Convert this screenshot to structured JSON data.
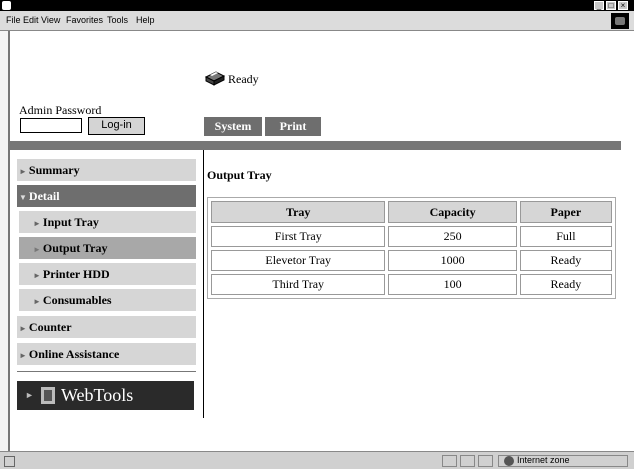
{
  "menubar": {
    "items": [
      "File",
      "Edit",
      "View",
      "Favorites",
      "Tools",
      "Help"
    ]
  },
  "status": {
    "printer_status": "Ready"
  },
  "admin": {
    "password_label": "Admin Password",
    "password_value": "",
    "login_label": "Log-in"
  },
  "tabs": [
    "System",
    "Print"
  ],
  "sidebar": {
    "summary": "Summary",
    "detail": "Detail",
    "input_tray": "Input Tray",
    "output_tray": "Output Tray",
    "printer_hdd": "Printer HDD",
    "consumables": "Consumables",
    "counter": "Counter",
    "online_assistance": "Online Assistance",
    "webtools": "WebTools"
  },
  "main": {
    "title": "Output Tray",
    "table": {
      "headers": [
        "Tray",
        "Capacity",
        "Paper"
      ],
      "rows": [
        [
          "First Tray",
          "250",
          "Full"
        ],
        [
          "Elevetor Tray",
          "1000",
          "Ready"
        ],
        [
          "Third Tray",
          "100",
          "Ready"
        ]
      ]
    }
  },
  "statusbar": {
    "zone": "Internet zone"
  },
  "colors": {
    "tab_bg": "#6e6e6e",
    "sidebar_bg": "#d6d6d6",
    "sidebar_selected": "#a8a8a8",
    "webtools_bg": "#2a2a2a"
  }
}
